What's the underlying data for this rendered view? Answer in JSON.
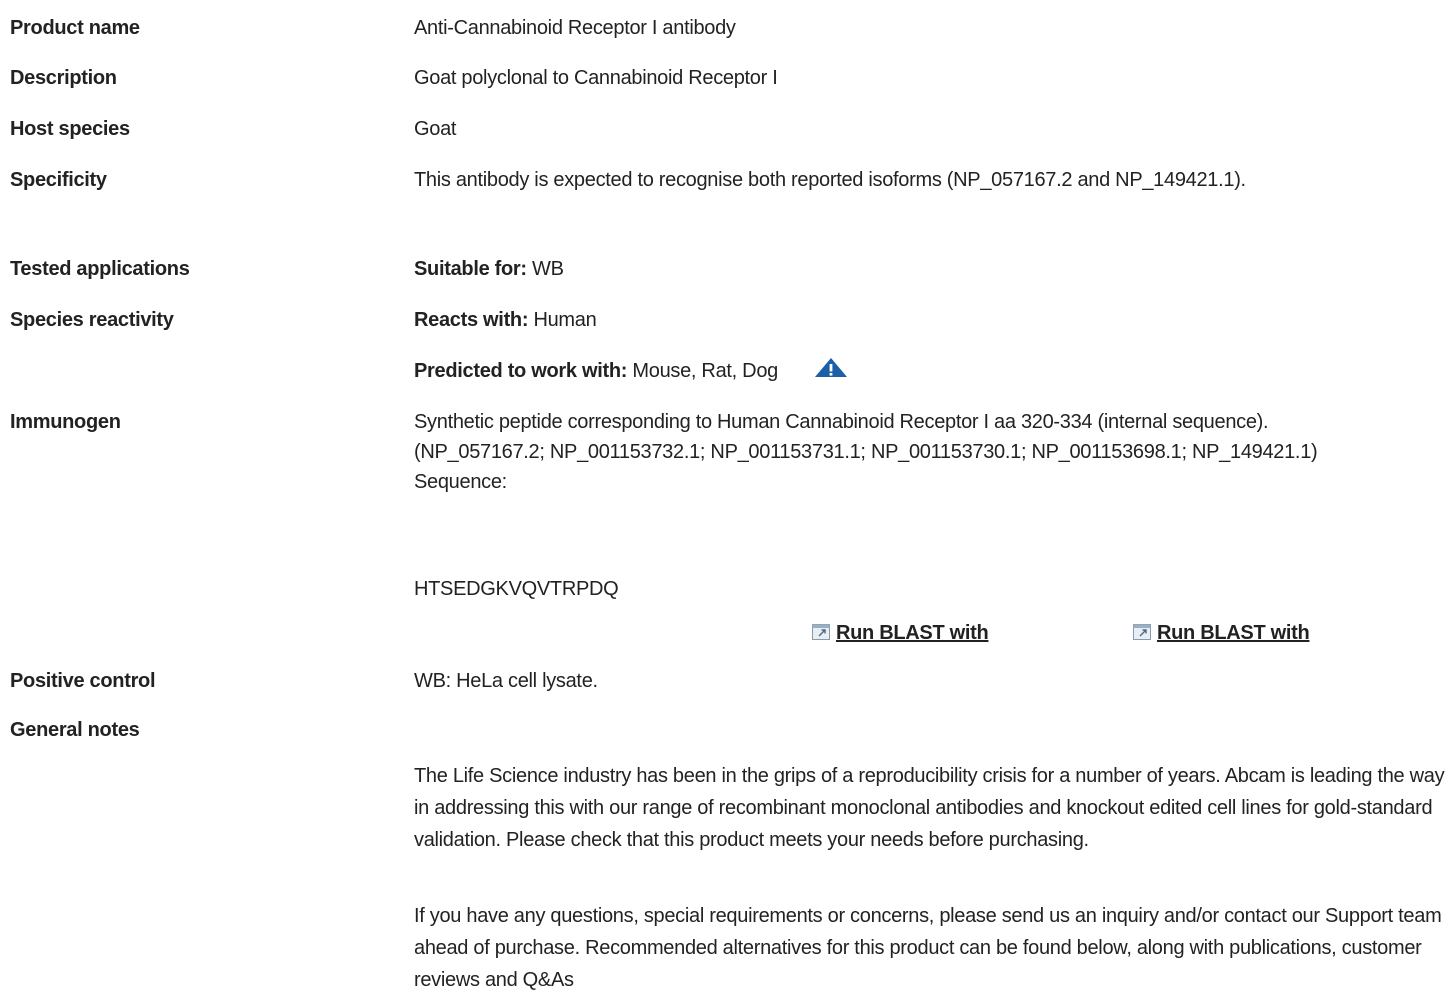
{
  "rows": {
    "product_name": {
      "label": "Product name",
      "value": "Anti-Cannabinoid Receptor I antibody"
    },
    "description": {
      "label": "Description",
      "value": "Goat polyclonal to Cannabinoid Receptor I"
    },
    "host_species": {
      "label": "Host species",
      "value": "Goat"
    },
    "specificity": {
      "label": "Specificity",
      "value": "This antibody is expected to recognise both reported isoforms (NP_057167.2 and NP_149421.1)."
    },
    "tested_applications": {
      "label": "Tested applications",
      "key": "Suitable for:",
      "value": "WB"
    },
    "species_reactivity": {
      "label": "Species reactivity",
      "reacts_key": "Reacts with:",
      "reacts_value": "Human",
      "predicted_key": "Predicted to work with:",
      "predicted_value": "Mouse, Rat, Dog"
    },
    "immunogen": {
      "label": "Immunogen",
      "value": "Synthetic peptide corresponding to Human Cannabinoid Receptor I aa 320-334 (internal sequence). (NP_057167.2; NP_001153732.1; NP_001153731.1; NP_001153730.1; NP_001153698.1; NP_149421.1)",
      "sequence_label": "Sequence:",
      "sequence": "HTSEDGKVQVTRPDQ",
      "blast_links": [
        "Run BLAST with",
        "Run BLAST with"
      ]
    },
    "positive_control": {
      "label": "Positive control",
      "value": "WB: HeLa cell lysate."
    },
    "general_notes": {
      "label": "General notes",
      "paragraphs": [
        "The Life Science industry has been in the grips of a reproducibility crisis for a number of years. Abcam is leading the way in addressing this with our range of recombinant monoclonal antibodies and knockout edited cell lines for gold-standard validation. Please check that this product meets your needs before purchasing.",
        "If you have any questions, special requirements or concerns, please send us an inquiry and/or contact our Support team ahead of purchase. Recommended alternatives for this product can be found below, along with publications, customer reviews and Q&As"
      ]
    }
  },
  "colors": {
    "text": "#222222",
    "warning_icon": "#1a5fa8",
    "link": "#222222"
  },
  "icons": {
    "warning": "warning-triangle-icon",
    "external": "external-link-icon"
  }
}
